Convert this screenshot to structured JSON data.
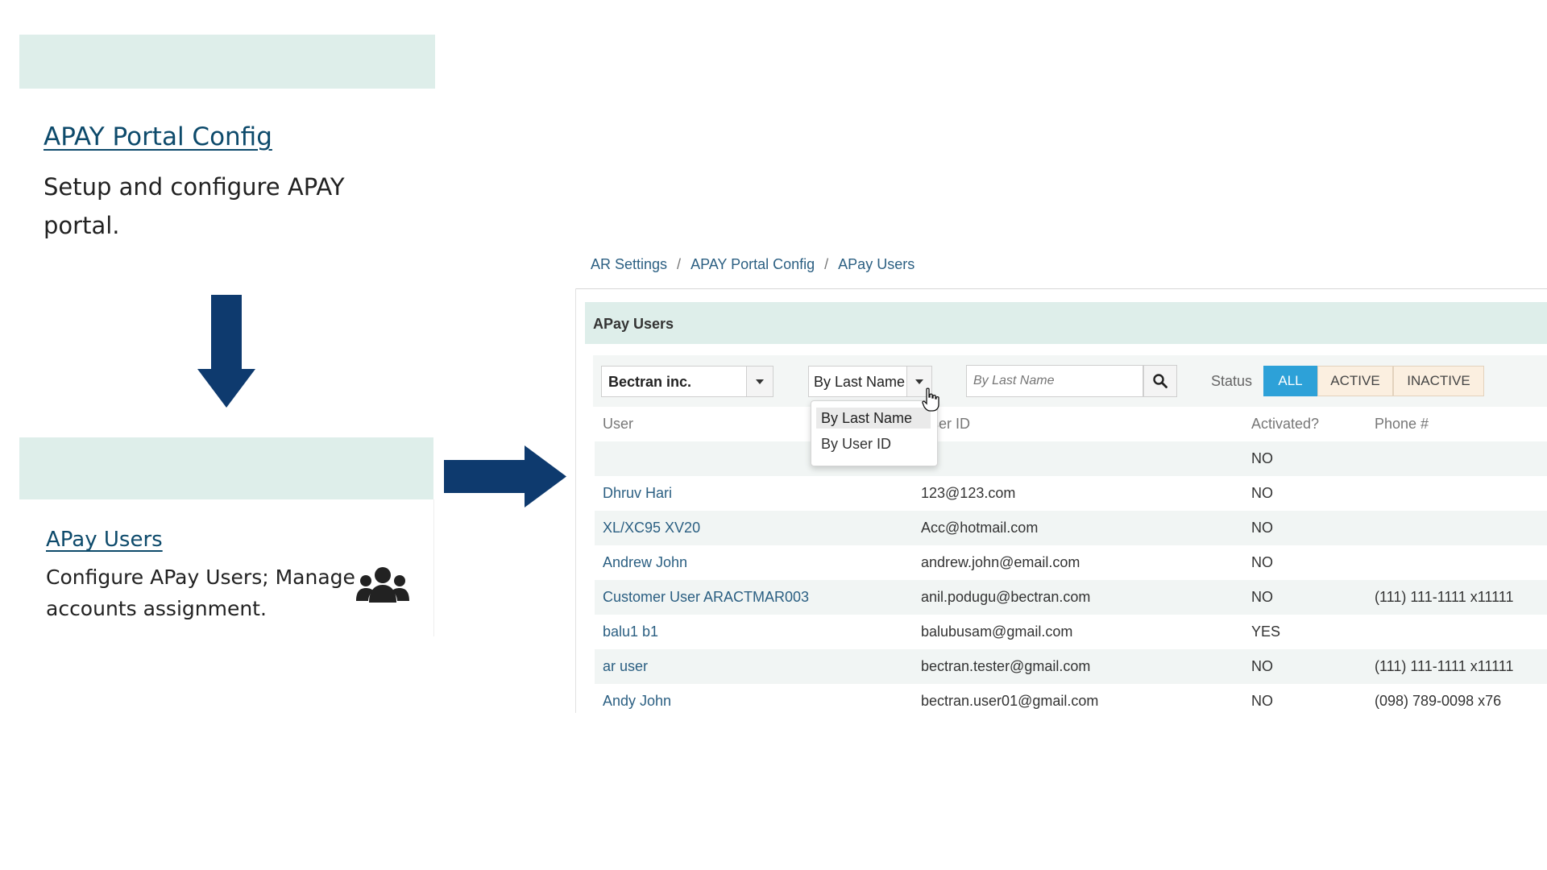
{
  "card_config": {
    "title": "APAY Portal Config",
    "description_line1": "Setup and configure APAY",
    "description_line2": "portal."
  },
  "card_users": {
    "title": "APay Users",
    "description_line1": "Configure APay Users; Manage",
    "description_line2": "accounts assignment.",
    "icon": "users-icon"
  },
  "breadcrumb": [
    "AR Settings",
    "APAY Portal Config",
    "APay Users"
  ],
  "panel": {
    "title": "APay Users",
    "company_select": "Bectran inc.",
    "search_by_select": "By Last Name",
    "search_placeholder": "By Last Name",
    "status_label": "Status",
    "status_options": [
      "ALL",
      "ACTIVE",
      "INACTIVE"
    ],
    "status_selected": "ALL",
    "search_by_options": [
      "By Last Name",
      "By User ID"
    ]
  },
  "table": {
    "headers": [
      "User",
      "User ID",
      "Activated?",
      "Phone #"
    ],
    "rows": [
      {
        "user": "",
        "user_id": "",
        "activated": "NO",
        "phone": ""
      },
      {
        "user": "Dhruv Hari",
        "user_id": "123@123.com",
        "activated": "NO",
        "phone": ""
      },
      {
        "user": "XL/XC95 XV20",
        "user_id": "Acc@hotmail.com",
        "activated": "NO",
        "phone": ""
      },
      {
        "user": "Andrew John",
        "user_id": "andrew.john@email.com",
        "activated": "NO",
        "phone": ""
      },
      {
        "user": "Customer User ARACTMAR003",
        "user_id": "anil.podugu@bectran.com",
        "activated": "NO",
        "phone": "(111) 111-1111 x11111"
      },
      {
        "user": "balu1 b1",
        "user_id": "balubusam@gmail.com",
        "activated": "YES",
        "phone": ""
      },
      {
        "user": "ar user",
        "user_id": "bectran.tester@gmail.com",
        "activated": "NO",
        "phone": "(111) 111-1111 x11111"
      },
      {
        "user": "Andy John",
        "user_id": "bectran.user01@gmail.com",
        "activated": "NO",
        "phone": "(098) 789-0098 x76"
      }
    ]
  },
  "colors": {
    "arrow": "#0e3a6e",
    "teal_band": "#deeeea",
    "active_blue": "#2da1d8",
    "link": "#2b5f82"
  }
}
